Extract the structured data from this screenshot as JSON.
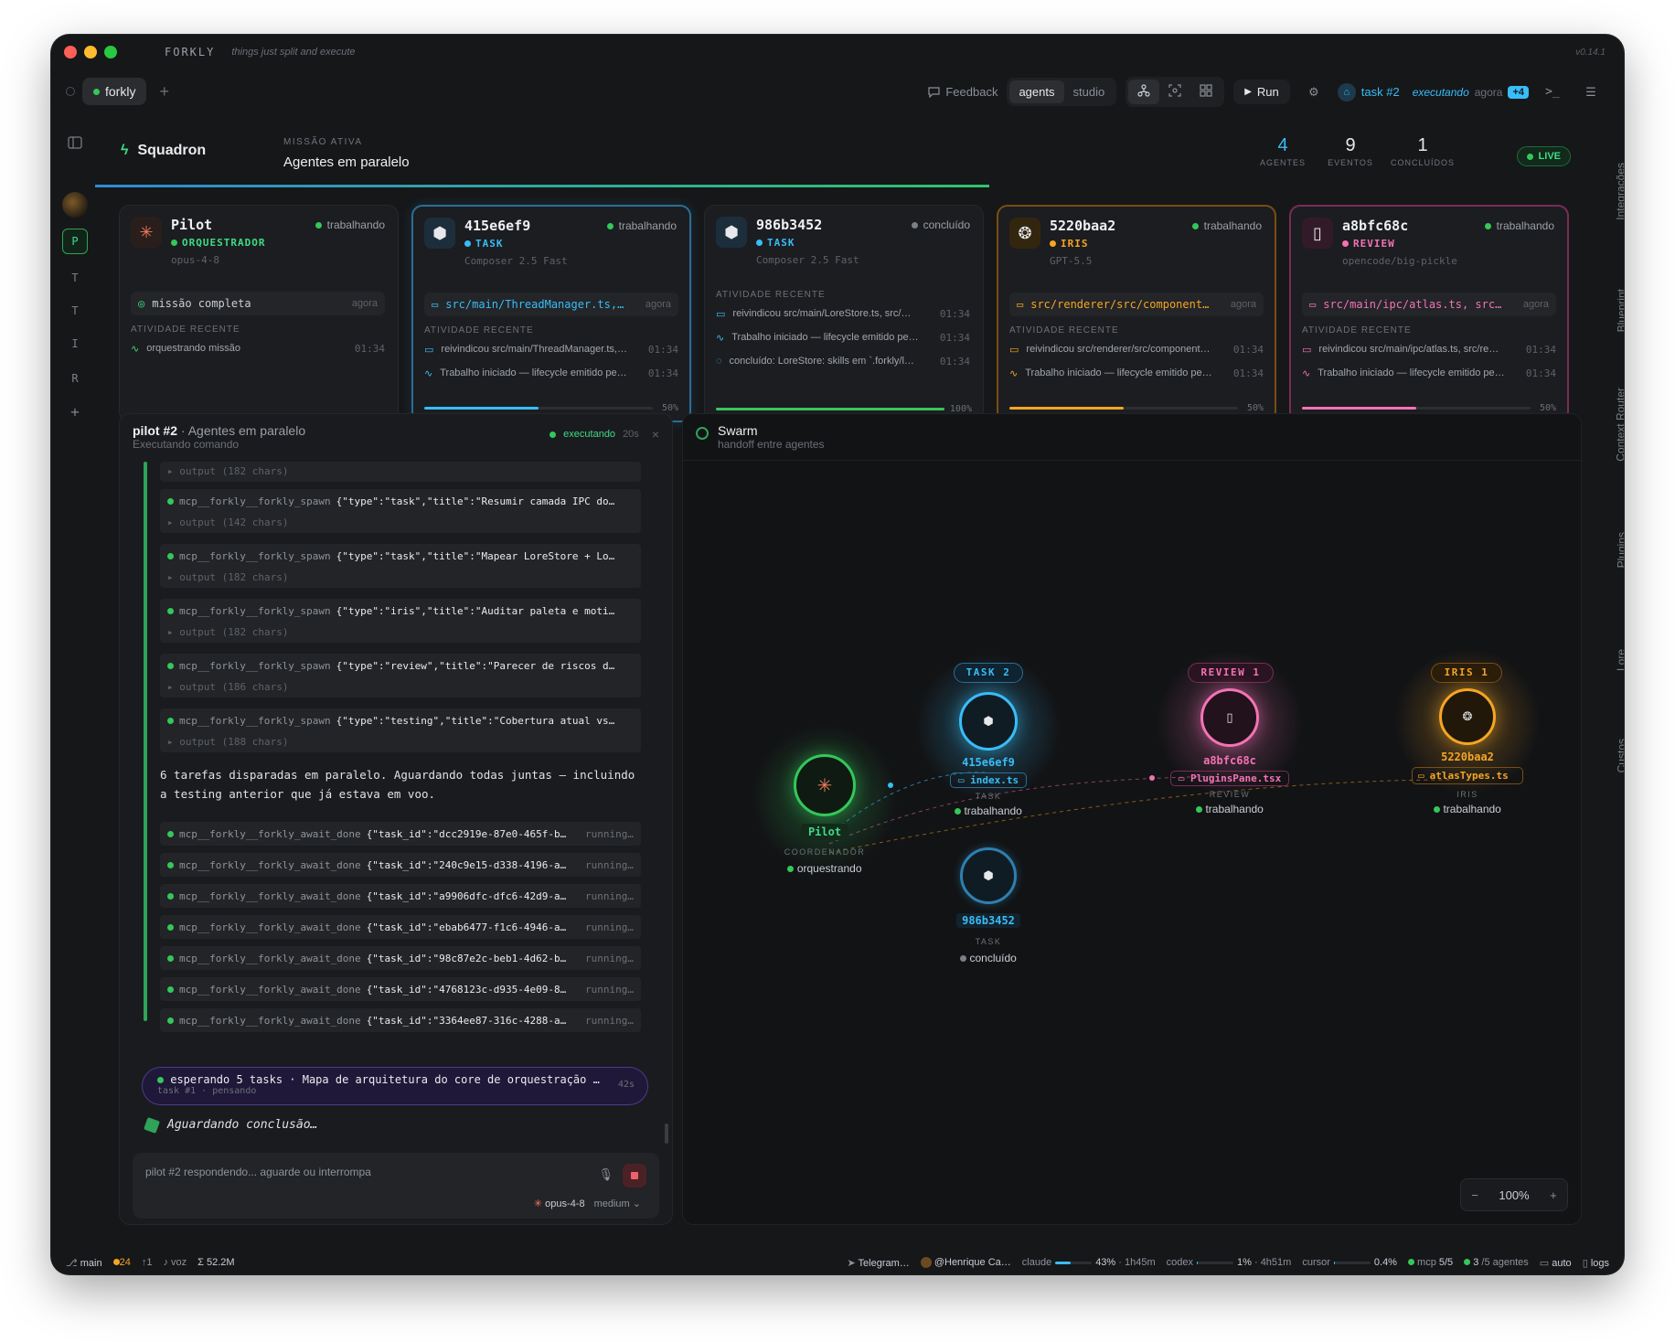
{
  "titlebar": {
    "app": "FORKLY",
    "tagline": "things just split and execute",
    "version": "v0.14.1"
  },
  "tabs": {
    "active": "forkly"
  },
  "toolbar": {
    "feedback": "Feedback",
    "seg_agents": "agents",
    "seg_studio": "studio",
    "run": "Run",
    "task": "task #2",
    "task_state": "executando",
    "task_time": "agora",
    "task_badge": "+4"
  },
  "rail": {
    "items": [
      "P",
      "T",
      "T",
      "I",
      "R"
    ]
  },
  "right_rail": [
    "Integrações",
    "Blueprint",
    "Context Router",
    "Plugins",
    "Lore",
    "Custos"
  ],
  "squad": {
    "brand": "Squadron",
    "mission_label": "MISSÃO ATIVA",
    "mission": "Agentes em paralelo",
    "stats": [
      {
        "n": "4",
        "l": "AGENTES"
      },
      {
        "n": "9",
        "l": "EVENTOS"
      },
      {
        "n": "1",
        "l": "CONCLUÍDOS"
      }
    ],
    "live": "LIVE",
    "mission_progress": 0.6
  },
  "cards": [
    {
      "name": "Pilot",
      "status": "trabalhando",
      "role": "ORQUESTRADOR",
      "model": "opus-4-8",
      "file": "missão completa",
      "file_time": "agora",
      "activity_label": "ATIVIDADE RECENTE",
      "activity": [
        {
          "t": "orquestrando missão",
          "time": "01:34"
        }
      ],
      "progress": null,
      "pct": ""
    },
    {
      "name": "415e6ef9",
      "status": "trabalhando",
      "role": "TASK",
      "model": "Composer 2.5 Fast",
      "file": "src/main/ThreadManager.ts,…",
      "file_time": "agora",
      "activity_label": "ATIVIDADE RECENTE",
      "activity": [
        {
          "t": "reivindicou src/main/ThreadManager.ts,…",
          "time": "01:34"
        },
        {
          "t": "Trabalho iniciado — lifecycle emitido pe…",
          "time": "01:34"
        }
      ],
      "progress": 0.5,
      "pct": "50%"
    },
    {
      "name": "986b3452",
      "status": "concluído",
      "role": "TASK",
      "model": "Composer 2.5 Fast",
      "file": "",
      "file_time": "",
      "activity_label": "ATIVIDADE RECENTE",
      "activity": [
        {
          "t": "reivindicou src/main/LoreStore.ts, src/…",
          "time": "01:34"
        },
        {
          "t": "Trabalho iniciado — lifecycle emitido pe…",
          "time": "01:34"
        },
        {
          "t": "concluído: LoreStore: skills em `.forkly/l…",
          "time": "01:34"
        }
      ],
      "progress": 1.0,
      "pct": "100%"
    },
    {
      "name": "5220baa2",
      "status": "trabalhando",
      "role": "IRIS",
      "model": "GPT-5.5",
      "file": "src/renderer/src/component…",
      "file_time": "agora",
      "activity_label": "ATIVIDADE RECENTE",
      "activity": [
        {
          "t": "reivindicou src/renderer/src/component…",
          "time": "01:34"
        },
        {
          "t": "Trabalho iniciado — lifecycle emitido pe…",
          "time": "01:34"
        }
      ],
      "progress": 0.5,
      "pct": "50%"
    },
    {
      "name": "a8bfc68c",
      "status": "trabalhando",
      "role": "REVIEW",
      "model": "opencode/big-pickle",
      "file": "src/main/ipc/atlas.ts, src…",
      "file_time": "agora",
      "activity_label": "ATIVIDADE RECENTE",
      "activity": [
        {
          "t": "reivindicou src/main/ipc/atlas.ts, src/re…",
          "time": "01:34"
        },
        {
          "t": "Trabalho iniciado — lifecycle emitido pe…",
          "time": "01:34"
        }
      ],
      "progress": 0.5,
      "pct": "50%"
    }
  ],
  "pilot_panel": {
    "title": "pilot #2",
    "title_sep": "·",
    "title_rest": "Agentes em paralelo",
    "subtitle": "Executando comando",
    "exec": "executando",
    "exec_time": "20s",
    "first_output": "▸ output (182 chars)",
    "spawns": [
      {
        "name": "mcp__forkly__forkly_spawn",
        "arg": "{\"type\":\"task\",\"title\":\"Resumir camada IPC do…",
        "out": "▸ output (142 chars)"
      },
      {
        "name": "mcp__forkly__forkly_spawn",
        "arg": "{\"type\":\"task\",\"title\":\"Mapear LoreStore + Lo…",
        "out": "▸ output (182 chars)"
      },
      {
        "name": "mcp__forkly__forkly_spawn",
        "arg": "{\"type\":\"iris\",\"title\":\"Auditar paleta e moti…",
        "out": "▸ output (182 chars)"
      },
      {
        "name": "mcp__forkly__forkly_spawn",
        "arg": "{\"type\":\"review\",\"title\":\"Parecer de riscos d…",
        "out": "▸ output (186 chars)"
      },
      {
        "name": "mcp__forkly__forkly_spawn",
        "arg": "{\"type\":\"testing\",\"title\":\"Cobertura atual vs…",
        "out": "▸ output (188 chars)"
      }
    ],
    "message": "6 tarefas disparadas em paralelo. Aguardando todas juntas — incluindo a testing anterior que já estava em voo.",
    "awaits": [
      {
        "name": "mcp__forkly__forkly_await_done",
        "arg": "{\"task_id\":\"dcc2919e-87e0-465f-b…",
        "st": "running…"
      },
      {
        "name": "mcp__forkly__forkly_await_done",
        "arg": "{\"task_id\":\"240c9e15-d338-4196-a…",
        "st": "running…"
      },
      {
        "name": "mcp__forkly__forkly_await_done",
        "arg": "{\"task_id\":\"a9906dfc-dfc6-42d9-a…",
        "st": "running…"
      },
      {
        "name": "mcp__forkly__forkly_await_done",
        "arg": "{\"task_id\":\"ebab6477-f1c6-4946-a…",
        "st": "running…"
      },
      {
        "name": "mcp__forkly__forkly_await_done",
        "arg": "{\"task_id\":\"98c87e2c-beb1-4d62-b…",
        "st": "running…"
      },
      {
        "name": "mcp__forkly__forkly_await_done",
        "arg": "{\"task_id\":\"4768123c-d935-4e09-8…",
        "st": "running…"
      },
      {
        "name": "mcp__forkly__forkly_await_done",
        "arg": "{\"task_id\":\"3364ee87-316c-4288-a…",
        "st": "running…"
      }
    ],
    "wait_pill": "esperando 5 tasks · Mapa de arquitetura do core de orquestração (r…",
    "wait_pill_sub": "task #1 · pensando",
    "wait_pill_time": "42s",
    "awaiting": "Aguardando conclusão…",
    "composer_placeholder": "pilot #2 respondendo... aguarde ou interrompa",
    "composer_model": "opus-4-8",
    "composer_effort": "medium"
  },
  "swarm": {
    "title": "Swarm",
    "subtitle": "handoff entre agentes",
    "zoom": "100%",
    "pilot": {
      "name": "Pilot",
      "role": "COORDENADOR",
      "status": "orquestrando"
    },
    "groups": [
      {
        "label": "TASK 2"
      },
      {
        "label": "REVIEW 1"
      },
      {
        "label": "IRIS 1"
      }
    ],
    "nodes": [
      {
        "id": "415e6ef9",
        "file": "index.ts",
        "role": "TASK",
        "status": "trabalhando"
      },
      {
        "id": "986b3452",
        "file": "",
        "role": "TASK",
        "status": "concluído"
      },
      {
        "id": "a8bfc68c",
        "file": "PluginsPane.tsx",
        "role": "REVIEW",
        "status": "trabalhando"
      },
      {
        "id": "5220baa2",
        "file": "atlasTypes.ts",
        "role": "IRIS",
        "status": "trabalhando"
      }
    ]
  },
  "statusbar": {
    "branch": "main",
    "changes": "24",
    "ahead": "↑1",
    "voice": "voz",
    "tokens": "Σ 52.2M",
    "telegram": "Telegram…",
    "user": "@Henrique Ca…",
    "claude_label": "claude",
    "claude_pct": "43%",
    "claude_time": "1h45m",
    "claude_level": 0.43,
    "codex_label": "codex",
    "codex_pct": "1%",
    "codex_time": "4h51m",
    "codex_level": 0.01,
    "cursor_label": "cursor",
    "cursor_pct": "0.4%",
    "cursor_level": 0.004,
    "mcp": "mcp",
    "mcp_val": "5/5",
    "agents": "3",
    "agents_total": "/5 agentes",
    "auto": "auto",
    "logs": "logs"
  },
  "colors": {
    "task": "#38bdf8",
    "iris": "#f5a524",
    "review": "#f472b6",
    "pilot": "#34c759"
  }
}
